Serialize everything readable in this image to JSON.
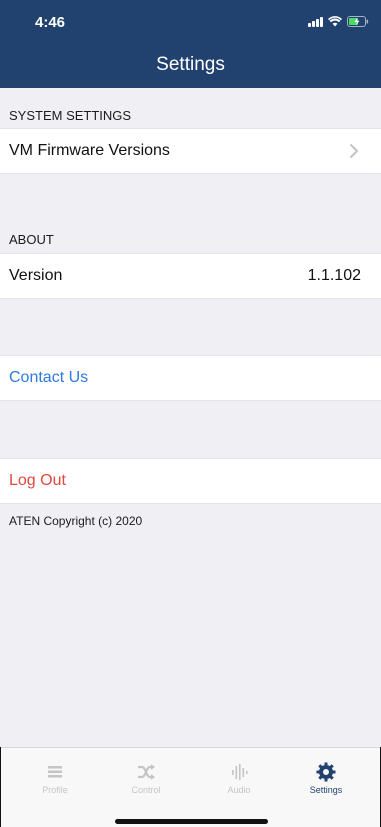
{
  "status_bar": {
    "time": "4:46"
  },
  "header": {
    "title": "Settings"
  },
  "sections": {
    "system": {
      "header": "SYSTEM SETTINGS",
      "row_label": "VM Firmware Versions"
    },
    "about": {
      "header": "ABOUT",
      "row_label": "Version",
      "row_value": "1.1.102"
    },
    "contact": {
      "label": "Contact Us"
    },
    "logout": {
      "label": "Log Out"
    }
  },
  "copyright": "ATEN Copyright (c) 2020",
  "tabs": [
    {
      "label": "Profile",
      "icon": "list-icon",
      "active": false
    },
    {
      "label": "Control",
      "icon": "shuffle-icon",
      "active": false
    },
    {
      "label": "Audio",
      "icon": "waveform-icon",
      "active": false
    },
    {
      "label": "Settings",
      "icon": "gear-icon",
      "active": true
    }
  ],
  "colors": {
    "header_bg": "#21426f",
    "link_blue": "#2e7ae0",
    "logout_red": "#e0473f",
    "tab_active": "#21426f",
    "tab_inactive": "#c5c5c5"
  }
}
